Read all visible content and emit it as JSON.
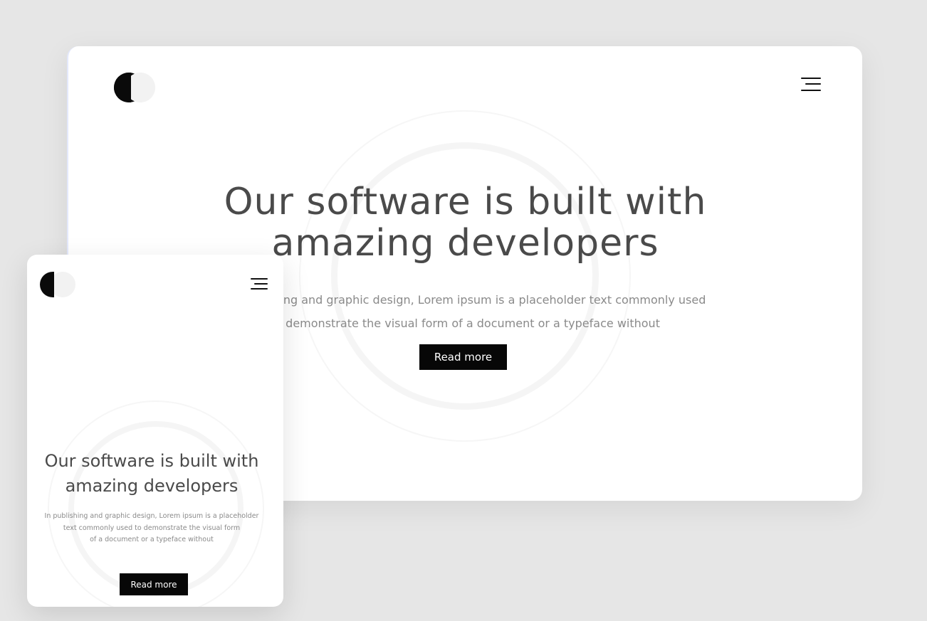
{
  "desktop": {
    "hero": {
      "title_line1": "Our software is built with",
      "title_line2": "amazing developers",
      "description_line1": "In publishing and graphic design, Lorem ipsum is a placeholder text commonly used",
      "description_line2": "to demonstrate the visual form of a document or a typeface without",
      "button_label": "Read more"
    }
  },
  "mobile": {
    "hero": {
      "title_line1": "Our software is built with",
      "title_line2": "amazing developers",
      "description_line1": "In publishing and graphic design, Lorem ipsum is a placeholder",
      "description_line2": "text commonly used to demonstrate the visual form",
      "description_line3": "of a document or a typeface without",
      "button_label": "Read more"
    }
  },
  "colors": {
    "background": "#e6e6e6",
    "card": "#ffffff",
    "title": "#4a4a4a",
    "text": "#8a8a8a",
    "button": "#070707",
    "logo_dark": "#0a0a0a",
    "logo_light": "#f2f2f2"
  },
  "icons": {
    "logo": "moon-logo-icon",
    "menu": "hamburger-menu-icon"
  }
}
